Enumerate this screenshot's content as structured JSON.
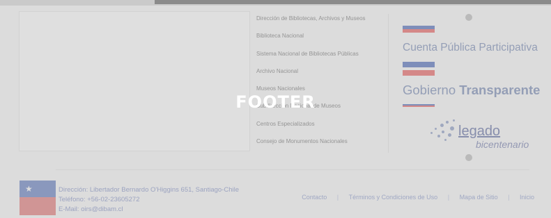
{
  "overlay_label": "FOOTER",
  "links": [
    "Dirección de Bibliotecas, Archivos y Museos",
    "Biblioteca Nacional",
    "Sistema Nacional de Bibliotecas Públicas",
    "Archivo Nacional",
    "Museos Nacionales",
    "Subdirección Nacional de Museos",
    "Centros Especializados",
    "Consejo de Monumentos Nacionales"
  ],
  "logos": {
    "cuenta_publica": "Cuenta Pública Participativa",
    "gobierno_word": "Gobierno",
    "gobierno_bold": "Transparente",
    "legado": "legado",
    "bicentenario": "bicentenario"
  },
  "contact": {
    "address": "Dirección: Libertador Bernardo O'Higgins 651, Santiago-Chile",
    "phone": "Teléfono: +56-02-23605272",
    "email": "E-Mail: oirs@dibam.cl"
  },
  "bottom_nav": [
    "Contacto",
    "Términos y Condiciones de Uso",
    "Mapa de Sitio",
    "Inicio"
  ],
  "colors": {
    "accent_blue": "#7f93c9",
    "accent_red": "#e88c8c"
  }
}
